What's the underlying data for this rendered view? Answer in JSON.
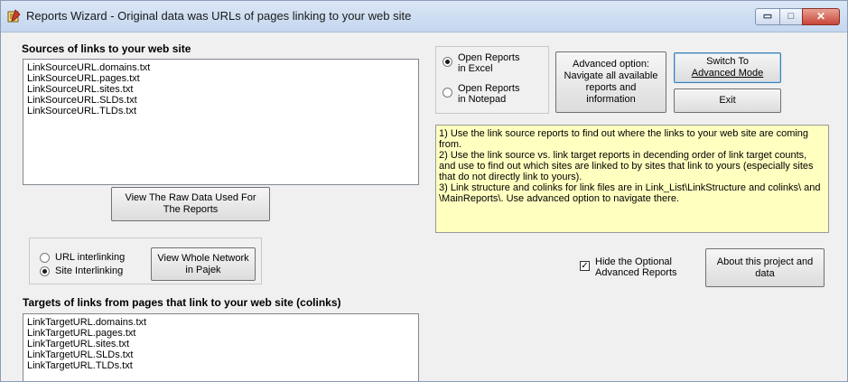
{
  "window": {
    "title": "Reports Wizard - Original data was URLs of pages linking to your web site",
    "controls": {
      "minimize": "▭",
      "maximize": "□",
      "close": "✕"
    }
  },
  "sources": {
    "heading": "Sources of links to your web site",
    "items": [
      "LinkSourceURL.domains.txt",
      "LinkSourceURL.pages.txt",
      "LinkSourceURL.sites.txt",
      "LinkSourceURL.SLDs.txt",
      "LinkSourceURL.TLDs.txt"
    ]
  },
  "raw_data_button": {
    "line1": "View The Raw Data Used For",
    "line2": "The Reports"
  },
  "interlinking": {
    "url_label": "URL interlinking",
    "site_label": "Site Interlinking",
    "selected": "site",
    "network_button": {
      "line1": "View Whole Network",
      "line2": "in Pajek"
    }
  },
  "targets": {
    "heading": "Targets of links from pages that link to your web site (colinks)",
    "items": [
      "LinkTargetURL.domains.txt",
      "LinkTargetURL.pages.txt",
      "LinkTargetURL.sites.txt",
      "LinkTargetURL.SLDs.txt",
      "LinkTargetURL.TLDs.txt"
    ]
  },
  "open_options": {
    "excel": {
      "line1": "Open Reports",
      "line2": "in Excel"
    },
    "notepad": {
      "line1": "Open Reports",
      "line2": "in Notepad"
    },
    "selected": "excel"
  },
  "advanced_button": {
    "line1": "Advanced option:",
    "line2": "Navigate all available",
    "line3": "reports and",
    "line4": "information"
  },
  "switch_button": {
    "line1": "Switch To",
    "line2": "Advanced Mode"
  },
  "exit_button": "Exit",
  "notes": [
    "1) Use the link source reports to find out where the links to your web site are coming from.",
    "2) Use the link source vs. link target reports in decending order of link target counts, and use to find out which sites are linked to by sites that link to yours (especially  sites that do not directly link to yours).",
    "3) Link structure and colinks for link files are in Link_List\\LinkStructure and colinks\\ and \\MainReports\\. Use advanced option to navigate there."
  ],
  "hide_optional": {
    "line1": "Hide the Optional",
    "line2": "Advanced Reports",
    "checked": true,
    "mark": "✓"
  },
  "about_button": {
    "line1": "About this project and",
    "line2": "data"
  }
}
